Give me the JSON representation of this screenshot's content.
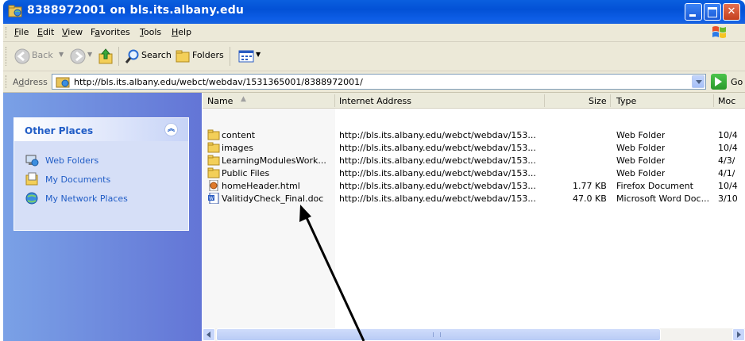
{
  "window": {
    "title": "8388972001 on bls.its.albany.edu"
  },
  "menu": [
    {
      "label": "File",
      "u": "F",
      "rest": "ile"
    },
    {
      "label": "Edit",
      "u": "E",
      "rest": "dit"
    },
    {
      "label": "View",
      "u": "V",
      "rest": "iew"
    },
    {
      "label": "Favorites",
      "pre": "F",
      "u": "a",
      "rest": "vorites"
    },
    {
      "label": "Tools",
      "u": "T",
      "rest": "ools"
    },
    {
      "label": "Help",
      "u": "H",
      "rest": "elp"
    }
  ],
  "toolbar": {
    "back": "Back",
    "search": "Search",
    "folders": "Folders"
  },
  "address": {
    "label_u": "d",
    "label_pre": "A",
    "label_rest": "dress",
    "url": "http://bls.its.albany.edu/webct/webdav/1531365001/8388972001/",
    "go": "Go"
  },
  "sidebar": {
    "title": "Other Places",
    "collapse": "»",
    "items": [
      {
        "label": "Web Folders",
        "icon": "web-folders-icon"
      },
      {
        "label": "My Documents",
        "icon": "my-documents-icon"
      },
      {
        "label": "My Network Places",
        "icon": "network-places-icon"
      }
    ]
  },
  "columns": {
    "name": "Name",
    "address": "Internet Address",
    "size": "Size",
    "type": "Type",
    "modified": "Moc"
  },
  "files": [
    {
      "name": "content",
      "address": "http://bls.its.albany.edu/webct/webdav/153...",
      "size": "",
      "type": "Web Folder",
      "modified": "10/4",
      "icon": "folder-icon"
    },
    {
      "name": "images",
      "address": "http://bls.its.albany.edu/webct/webdav/153...",
      "size": "",
      "type": "Web Folder",
      "modified": "10/4",
      "icon": "folder-icon"
    },
    {
      "name": "LearningModulesWork...",
      "address": "http://bls.its.albany.edu/webct/webdav/153...",
      "size": "",
      "type": "Web Folder",
      "modified": "4/3/",
      "icon": "folder-icon"
    },
    {
      "name": "Public Files",
      "address": "http://bls.its.albany.edu/webct/webdav/153...",
      "size": "",
      "type": "Web Folder",
      "modified": "4/1/",
      "icon": "folder-icon"
    },
    {
      "name": "homeHeader.html",
      "address": "http://bls.its.albany.edu/webct/webdav/153...",
      "size": "1.77 KB",
      "type": "Firefox Document",
      "modified": "10/4",
      "icon": "html-file-icon"
    },
    {
      "name": "ValitidyCheck_Final.doc",
      "address": "http://bls.its.albany.edu/webct/webdav/153...",
      "size": "47.0 KB",
      "type": "Microsoft Word Doc...",
      "modified": "3/10",
      "icon": "word-doc-icon"
    }
  ],
  "colors": {
    "titlebar": "#0351d6",
    "sidebar_link": "#215dc6",
    "chrome": "#ece9d8"
  }
}
